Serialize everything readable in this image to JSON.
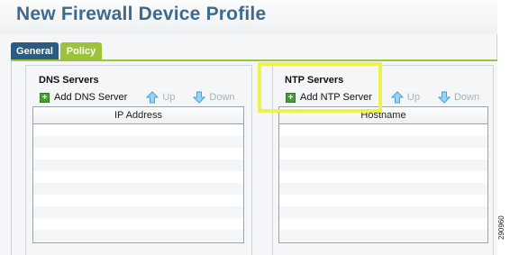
{
  "window": {
    "title": "New Firewall Device Profile"
  },
  "tabs": [
    {
      "label": "General",
      "selected": false
    },
    {
      "label": "Policy",
      "selected": true
    }
  ],
  "dns": {
    "title": "DNS Servers",
    "toolbar": {
      "add_label": "Add DNS Server",
      "up_label": "Up",
      "down_label": "Down"
    },
    "grid": {
      "columns": [
        "IP Address"
      ],
      "rows": []
    }
  },
  "ntp": {
    "title": "NTP Servers",
    "toolbar": {
      "add_label": "Add NTP Server",
      "up_label": "Up",
      "down_label": "Down"
    },
    "grid": {
      "columns": [
        "Hostname"
      ],
      "rows": []
    }
  },
  "figure_number": "290960",
  "colors": {
    "title_text": "#3f6a8e",
    "tab_general": "#2c5c7f",
    "tab_policy": "#9cc43a",
    "add_icon": "#45a033",
    "arrow_icon": "#4aa3d8",
    "highlight_callout": "#eef24f"
  },
  "icons": {
    "add": "plus-icon",
    "up": "arrow-up-icon",
    "down": "arrow-down-icon"
  }
}
